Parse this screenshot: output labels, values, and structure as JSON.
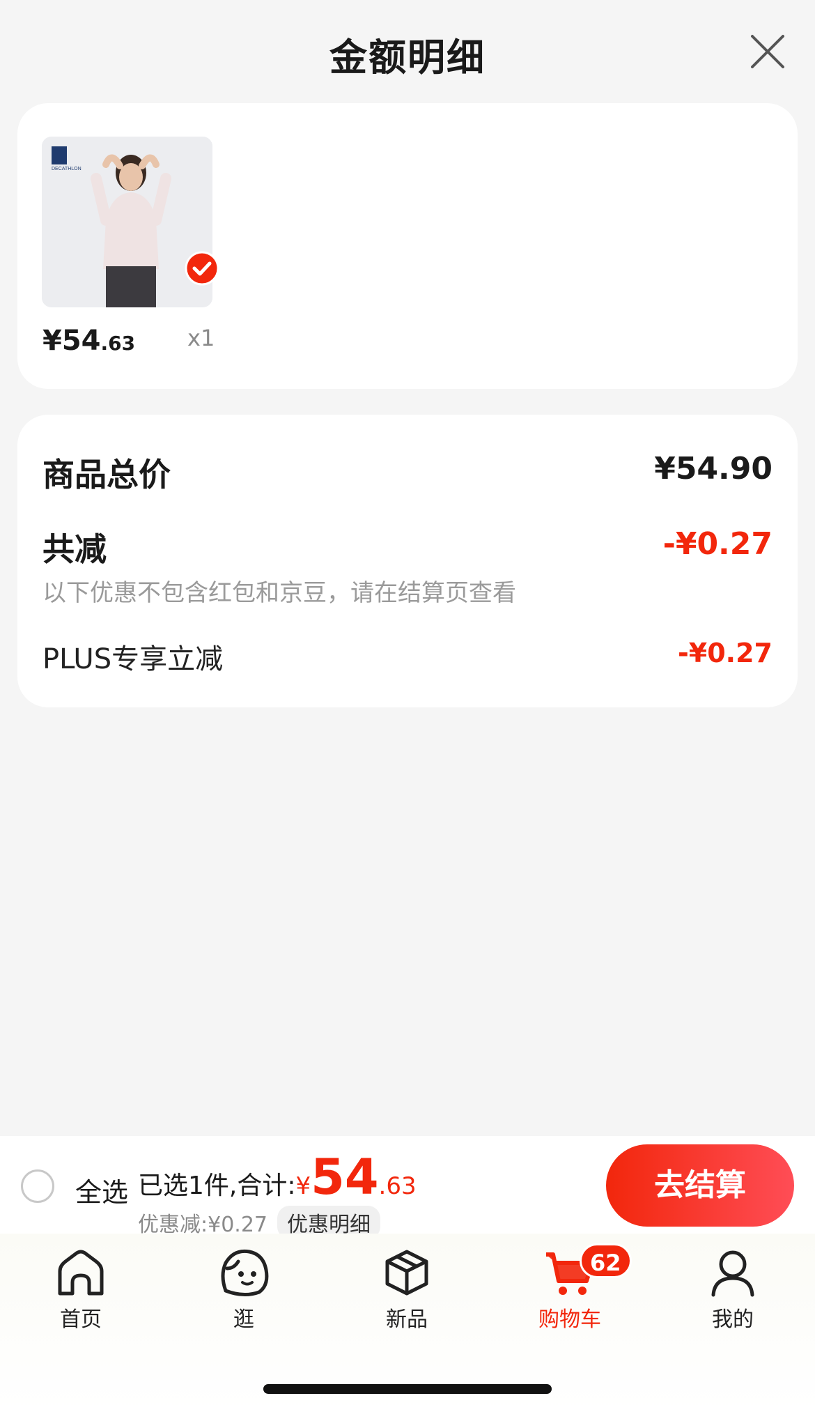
{
  "sheet": {
    "title": "金额明细"
  },
  "items": [
    {
      "price_int": "¥54",
      "price_dec": ".63",
      "qty": "x1",
      "thumb_brand": "DECATHLON"
    }
  ],
  "summary": {
    "total_label": "商品总价",
    "total_value": "¥54.90",
    "discount_label": "共减",
    "discount_value": "-¥0.27",
    "note": "以下优惠不包含红包和京豆，请在结算页查看",
    "plus_label": "PLUS专享立减",
    "plus_value": "-¥0.27"
  },
  "bottom_bar": {
    "select_all": "全选",
    "selected_text": "已选1件,合计:",
    "total_yen": "¥",
    "total_int": "54",
    "total_dec": ".63",
    "discount_text": "优惠减:¥0.27",
    "detail_chip": "优惠明细",
    "checkout": "去结算"
  },
  "tabs": [
    {
      "label": "首页",
      "icon": "home-icon"
    },
    {
      "label": "逛",
      "icon": "face-icon"
    },
    {
      "label": "新品",
      "icon": "cube-icon"
    },
    {
      "label": "购物车",
      "icon": "cart-icon",
      "badge": "62",
      "active": true
    },
    {
      "label": "我的",
      "icon": "user-icon"
    }
  ],
  "colors": {
    "accent": "#f2270c",
    "background": "#f5f5f5"
  }
}
